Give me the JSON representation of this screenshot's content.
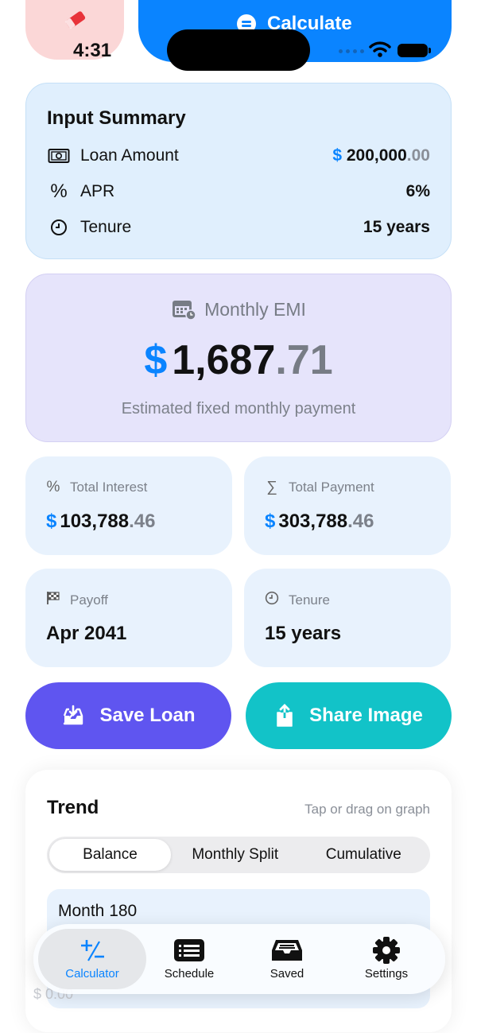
{
  "top_buttons": {
    "calculate_label": "Calculate"
  },
  "status_bar": {
    "time": "4:31"
  },
  "input_summary": {
    "title": "Input Summary",
    "loan_amount": {
      "label": "Loan Amount",
      "currency": "$",
      "whole": "200,000",
      "decimal": ".00"
    },
    "apr": {
      "label": "APR",
      "value": "6%"
    },
    "tenure": {
      "label": "Tenure",
      "value": "15 years"
    }
  },
  "emi": {
    "label": "Monthly EMI",
    "currency": "$",
    "whole": "1,687",
    "decimal": ".71",
    "subtitle": "Estimated fixed monthly payment"
  },
  "stats": {
    "total_interest": {
      "label": "Total Interest",
      "currency": "$",
      "whole": "103,788",
      "decimal": ".46"
    },
    "total_payment": {
      "label": "Total Payment",
      "currency": "$",
      "whole": "303,788",
      "decimal": ".46"
    },
    "payoff": {
      "label": "Payoff",
      "value": "Apr 2041"
    },
    "tenure": {
      "label": "Tenure",
      "value": "15 years"
    }
  },
  "actions": {
    "save_label": "Save Loan",
    "share_label": "Share Image"
  },
  "trend": {
    "title": "Trend",
    "hint": "Tap or drag on graph",
    "segments": [
      "Balance",
      "Monthly Split",
      "Cumulative"
    ],
    "selected_segment": "Balance",
    "month_label": "Month 180",
    "faded_value": "$ 0.00"
  },
  "tabbar": {
    "tabs": [
      {
        "label": "Calculator",
        "icon": "plus-minus-icon",
        "active": true
      },
      {
        "label": "Schedule",
        "icon": "list-icon",
        "active": false
      },
      {
        "label": "Saved",
        "icon": "tray-icon",
        "active": false
      },
      {
        "label": "Settings",
        "icon": "gear-icon",
        "active": false
      }
    ]
  },
  "colors": {
    "accent": "#0a84ff",
    "save_button": "#5f55f0",
    "share_button": "#12c3c8",
    "summary_bg": "#e0effd",
    "emi_bg": "#e6e4fb"
  }
}
